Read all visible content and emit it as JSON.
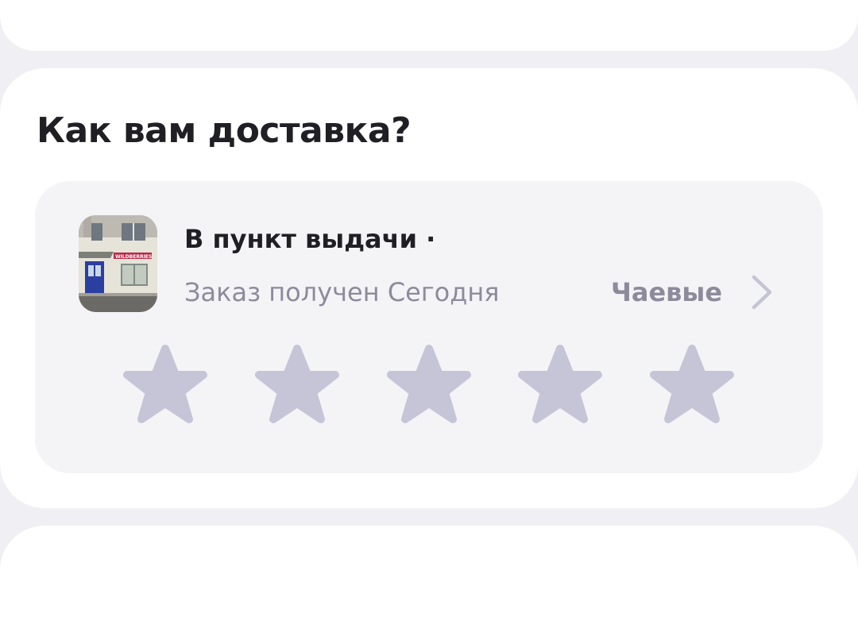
{
  "delivery_rating": {
    "title": "Как вам доставка?",
    "pickup_point": {
      "title": "В пункт выдачи · ",
      "status": "Заказ получен Сегодня",
      "photo_icon": "pickup-point-photo",
      "photo_sign_text": "WILDBERRIES"
    },
    "tips": {
      "label": "Чаевые",
      "icon": "chevron-right-icon"
    },
    "rating": {
      "max": 5,
      "value": 0,
      "icon": "star-icon"
    }
  },
  "colors": {
    "background": "#f0eff4",
    "card": "#ffffff",
    "panel": "#f4f4f7",
    "title_text": "#1f1f24",
    "muted_text": "#8d8b9b",
    "star_empty": "#c6c5d7"
  }
}
